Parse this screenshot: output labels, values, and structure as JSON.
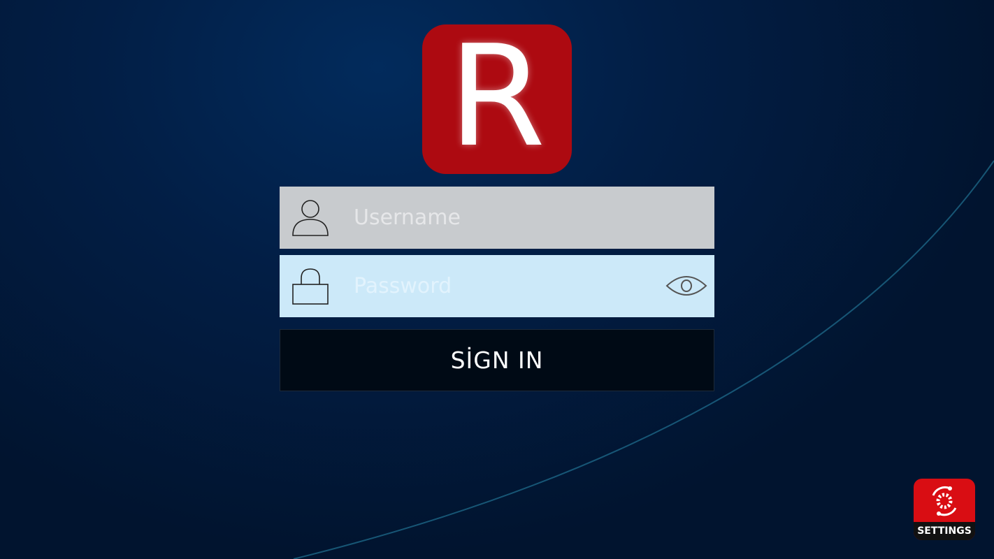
{
  "logo": {
    "letter": "R",
    "color": "#ad0a11"
  },
  "login": {
    "username_placeholder": "Username",
    "password_placeholder": "Password",
    "sign_in_label": "SİGN IN"
  },
  "icons": {
    "username": "user-icon",
    "password": "lock-icon",
    "toggle": "eye-icon",
    "settings": "gear-icon"
  },
  "settings": {
    "label": "SETTINGS",
    "color": "#d90d13"
  },
  "colors": {
    "username_field": "#c8cbce",
    "password_field": "#cce9f9",
    "sign_in_button": "#000a15"
  }
}
